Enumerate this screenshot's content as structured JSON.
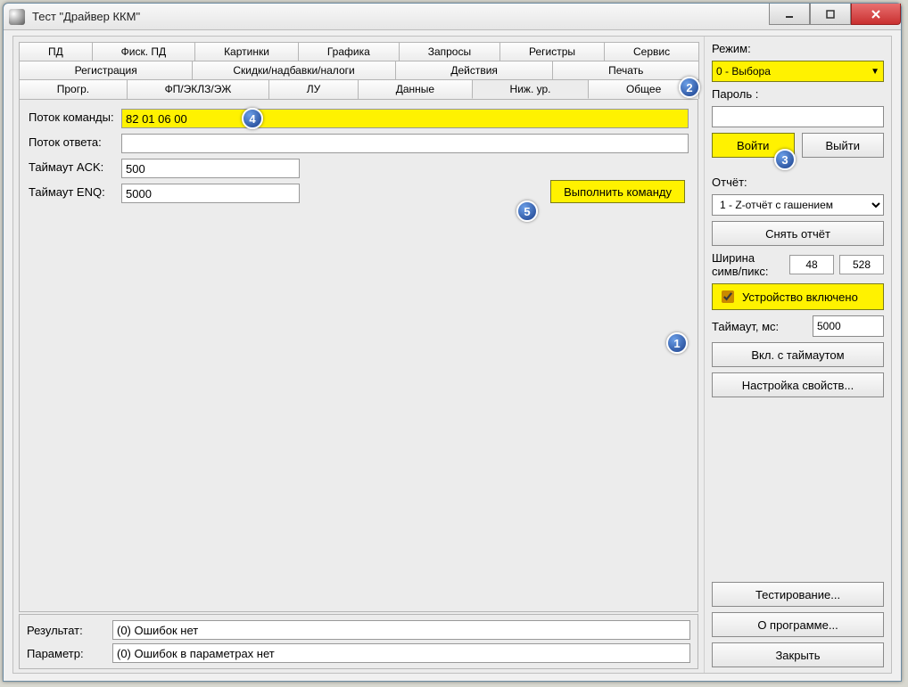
{
  "window": {
    "title": "Тест \"Драйвер ККМ\""
  },
  "tabs": {
    "row1": [
      "ПД",
      "Фиск. ПД",
      "Картинки",
      "Графика",
      "Запросы",
      "Регистры",
      "Сервис"
    ],
    "row2": [
      "Регистрация",
      "Скидки/надбавки/налоги",
      "Действия",
      "Печать"
    ],
    "row3": [
      "Прогр.",
      "ФП/ЭКЛЗ/ЭЖ",
      "ЛУ",
      "Данные",
      "Ниж. ур.",
      "Общее"
    ],
    "active": "Ниж. ур."
  },
  "form": {
    "cmd_label": "Поток команды:",
    "cmd_value": "82 01 06 00",
    "resp_label": "Поток ответа:",
    "resp_value": "",
    "ack_label": "Таймаут ACK:",
    "ack_value": "500",
    "enq_label": "Таймаут ENQ:",
    "enq_value": "5000",
    "exec_label": "Выполнить команду"
  },
  "status": {
    "result_label": "Результат:",
    "result_value": "(0) Ошибок нет",
    "param_label": "Параметр:",
    "param_value": "(0) Ошибок в параметрах нет"
  },
  "side": {
    "mode_label": "Режим:",
    "mode_value": "0 - Выбора",
    "password_label": "Пароль :",
    "password_value": "",
    "login_label": "Войти",
    "logout_label": "Выйти",
    "report_label": "Отчёт:",
    "report_value": "1 - Z-отчёт с гашением",
    "report_snap": "Снять отчёт",
    "width_label": "Ширина симв/пикс:",
    "width_a": "48",
    "width_b": "528",
    "device_on": "Устройство включено",
    "timeout_label": "Таймаут, мс:",
    "timeout_value": "5000",
    "timeout_btn": "Вкл. с таймаутом",
    "props_btn": "Настройка свойств...",
    "testing_btn": "Тестирование...",
    "about_btn": "О программе...",
    "close_btn": "Закрыть"
  },
  "bubbles": {
    "b1": "1",
    "b2": "2",
    "b3": "3",
    "b4": "4",
    "b5": "5"
  }
}
